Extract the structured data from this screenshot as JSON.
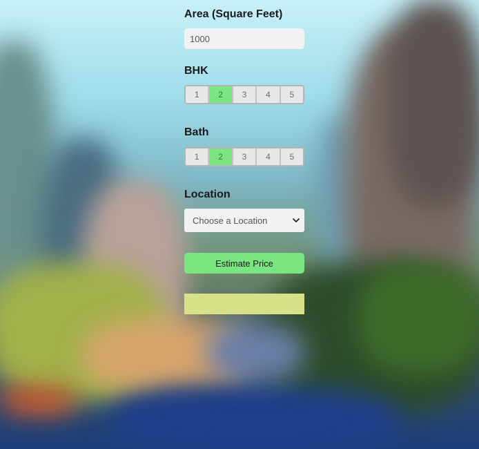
{
  "form": {
    "area_label": "Area (Square Feet)",
    "area_value": "1000",
    "bhk_label": "BHK",
    "bhk_options": [
      "1",
      "2",
      "3",
      "4",
      "5"
    ],
    "bhk_selected": "2",
    "bath_label": "Bath",
    "bath_options": [
      "1",
      "2",
      "3",
      "4",
      "5"
    ],
    "bath_selected": "2",
    "location_label": "Location",
    "location_selected": "Choose a Location",
    "estimate_button": "Estimate Price",
    "result_text": ""
  },
  "colors": {
    "accent_green": "#7be681",
    "result_bg": "#d8e08a"
  },
  "icons": {
    "select_arrow": "chevron-down-icon"
  }
}
